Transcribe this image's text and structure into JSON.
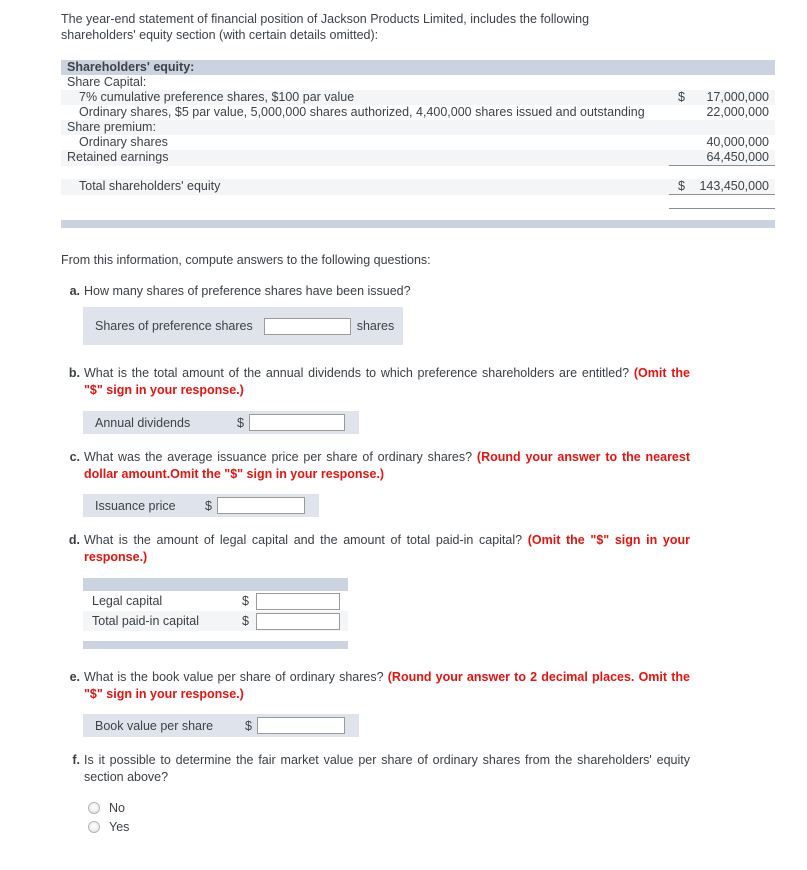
{
  "intro": {
    "line1": "The year-end statement of financial position of Jackson Products Limited, includes the following",
    "line2": "shareholders' equity section (with certain details omitted):"
  },
  "equity_table": {
    "header": "Shareholders' equity:",
    "rows": [
      {
        "label": "Share Capital:",
        "currency": "",
        "amount": ""
      },
      {
        "label": "7% cumulative preference shares, $100 par value",
        "currency": "$",
        "amount": "17,000,000"
      },
      {
        "label": "Ordinary shares, $5 par value, 5,000,000 shares authorized, 4,400,000 shares issued and outstanding",
        "currency": "",
        "amount": "22,000,000"
      },
      {
        "label": "Share premium:",
        "currency": "",
        "amount": ""
      },
      {
        "label": "Ordinary shares",
        "currency": "",
        "amount": "40,000,000"
      },
      {
        "label": "Retained earnings",
        "currency": "",
        "amount": "64,450,000"
      }
    ],
    "total_label": "Total shareholders' equity",
    "total_currency": "$",
    "total_amount": "143,450,000"
  },
  "questions_intro": "From this information, compute answers to the following questions:",
  "questions": {
    "a": {
      "letter": "a.",
      "text": "How many shares of preference shares have been issued?",
      "field_label": "Shares of preference shares",
      "field_value": "",
      "unit_suffix": "shares"
    },
    "b": {
      "letter": "b.",
      "text": "What is the total amount of the annual dividends to which preference shareholders are entitled? ",
      "note": "(Omit the \"$\" sign in your response.)",
      "field_label": "Annual dividends",
      "currency": "$",
      "field_value": ""
    },
    "c": {
      "letter": "c.",
      "text": "What was the average issuance price per share of ordinary shares? ",
      "note": "(Round your answer to the nearest dollar amount.Omit the \"$\" sign in your response.)",
      "field_label": "Issuance price",
      "currency": "$",
      "field_value": ""
    },
    "d": {
      "letter": "d.",
      "text": "What is the amount of legal capital and the amount of total paid-in capital? ",
      "note": "(Omit the \"$\" sign in your response.)",
      "rows": [
        {
          "label": "Legal capital",
          "currency": "$",
          "value": ""
        },
        {
          "label": "Total paid-in capital",
          "currency": "$",
          "value": ""
        }
      ]
    },
    "e": {
      "letter": "e.",
      "text": "What is the book value per share of ordinary shares? ",
      "note": "(Round your answer to 2 decimal places. Omit the \"$\" sign in your response.)",
      "field_label": "Book value per share",
      "currency": "$",
      "field_value": ""
    },
    "f": {
      "letter": "f.",
      "text": "Is it possible to determine the fair market value per share of ordinary shares from the shareholders' equity section above?",
      "options": [
        {
          "label": "No",
          "selected": false
        },
        {
          "label": "Yes",
          "selected": false
        }
      ]
    }
  },
  "colors": {
    "band": "#ccd3e0",
    "panel": "#dfe3ec",
    "row_gray": "#f4f5f6",
    "note_red": "#e8130f",
    "text": "#3d4247"
  }
}
